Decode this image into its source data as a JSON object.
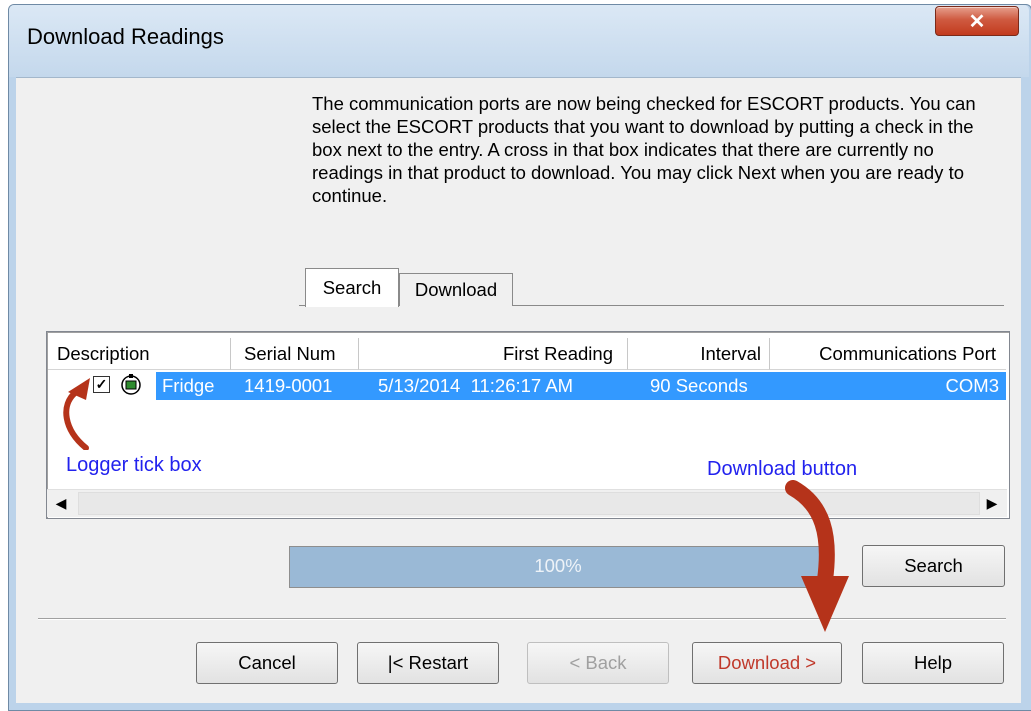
{
  "window": {
    "title": "Download Readings"
  },
  "instructions": "The communication ports are now being checked for ESCORT products. You can select the ESCORT products that you want to download by putting a check in the box next to the entry. A cross in that box indicates that there are currently no readings in that product to download. You may click Next when you are ready to continue.",
  "tabs": [
    {
      "label": "Search"
    },
    {
      "label": "Download"
    }
  ],
  "list": {
    "columns": [
      "Description",
      "Serial Num",
      "First Reading",
      "Interval",
      "Communications Port"
    ],
    "rows": [
      {
        "checked": true,
        "description": "Fridge",
        "serial": "1419-0001",
        "first_reading": "5/13/2014  11:26:17 AM",
        "interval": "90 Seconds",
        "port": "COM3"
      }
    ]
  },
  "progress": {
    "label": "100%",
    "value": 1.0
  },
  "buttons": {
    "search": "Search",
    "cancel": "Cancel",
    "restart": "|< Restart",
    "back": "< Back",
    "download": "Download >",
    "help": "Help"
  },
  "annotations": {
    "tickbox": "Logger tick box",
    "download": "Download button"
  },
  "colors": {
    "selection": "#3399ff",
    "annotation_text": "#2222ee",
    "annotation_arrow": "#b5331a",
    "close_button": "#c9452a"
  },
  "icons": {
    "close": "close-icon",
    "logger": "logger-device-icon"
  }
}
